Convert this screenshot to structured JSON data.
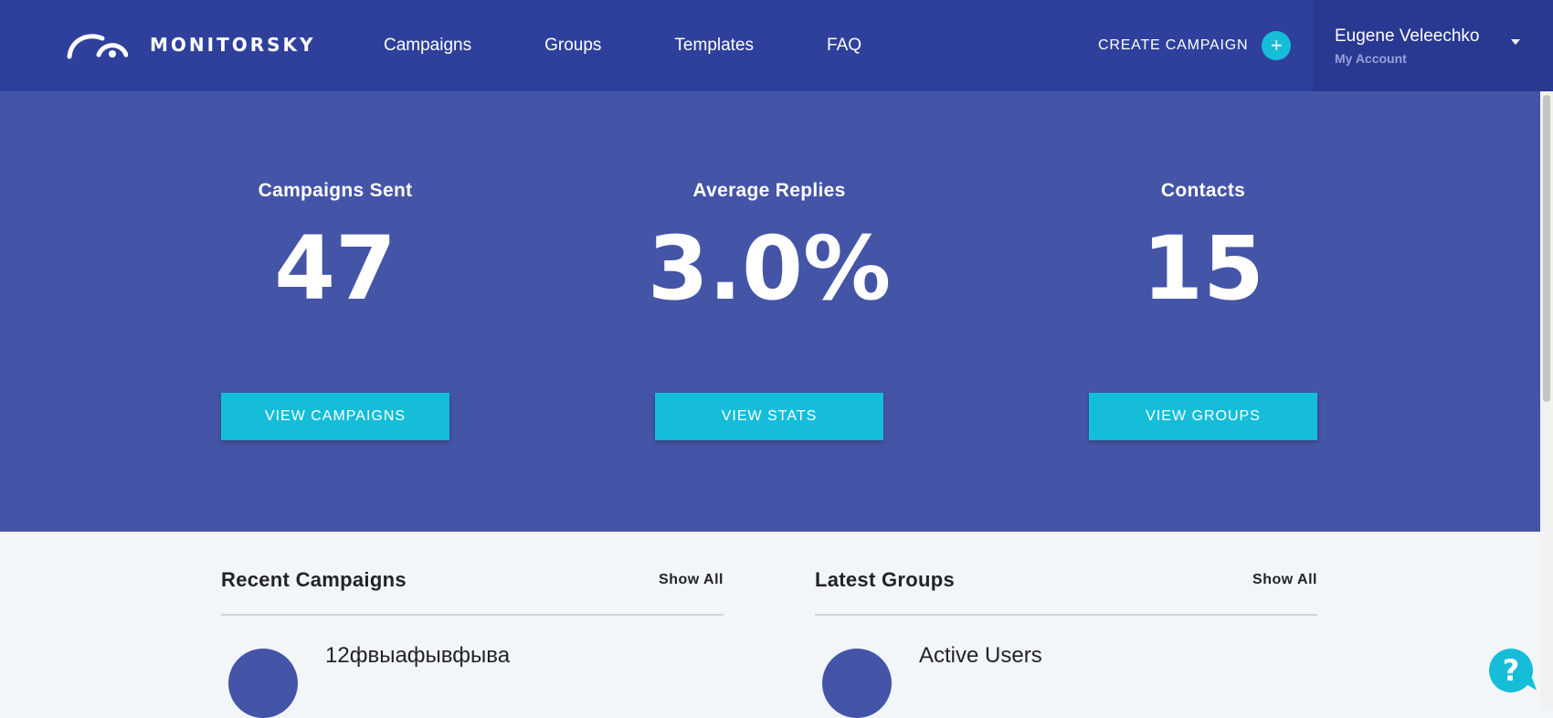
{
  "header": {
    "brand": "MONITORSKY",
    "nav": [
      {
        "label": "Campaigns"
      },
      {
        "label": "Groups"
      },
      {
        "label": "Templates"
      },
      {
        "label": "FAQ"
      }
    ],
    "create_campaign_label": "CREATE CAMPAIGN",
    "create_campaign_icon": "+",
    "account": {
      "name": "Eugene Veleechko",
      "subtitle": "My Account"
    }
  },
  "stats": [
    {
      "title": "Campaigns Sent",
      "value": "47",
      "button": "VIEW CAMPAIGNS"
    },
    {
      "title": "Average Replies",
      "value": "3.0%",
      "button": "VIEW STATS"
    },
    {
      "title": "Contacts",
      "value": "15",
      "button": "VIEW GROUPS"
    }
  ],
  "panels": {
    "recent_campaigns": {
      "title": "Recent Campaigns",
      "show_all": "Show All",
      "items": [
        {
          "name": "12фвыафывфыва"
        }
      ]
    },
    "latest_groups": {
      "title": "Latest Groups",
      "show_all": "Show All",
      "items": [
        {
          "name": "Active Users"
        }
      ]
    }
  },
  "help": {
    "glyph": "?"
  },
  "colors": {
    "header_bg": "#2f409c",
    "account_bg": "#293891",
    "hero_bg": "#4454a6",
    "accent": "#15bdd9",
    "page_bg": "#f3f6f9"
  }
}
